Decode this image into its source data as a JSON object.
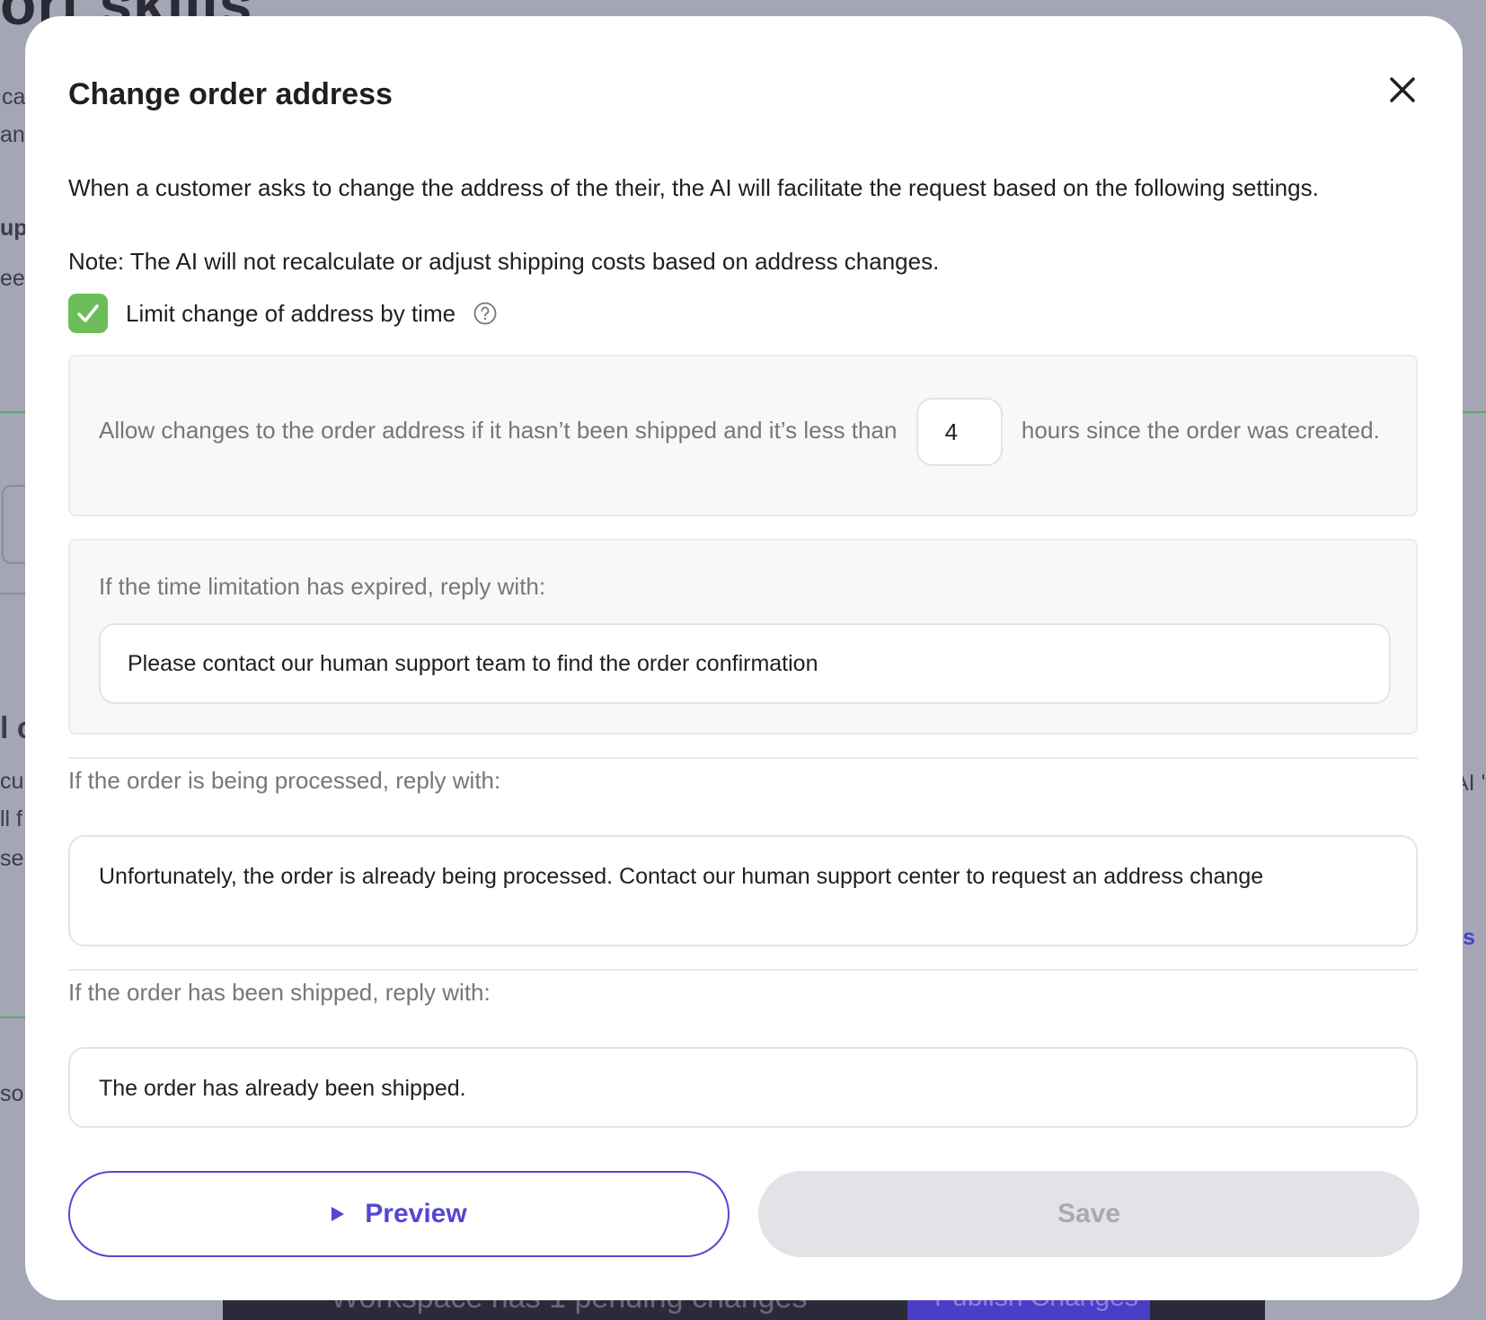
{
  "background": {
    "title_fragment": "ort skills",
    "fragments": [
      "ca",
      "an",
      "up",
      "ee",
      "l c",
      "cu",
      "ll f",
      "se",
      "so",
      "AI '",
      "s"
    ],
    "bottom_bar_text": "Workspace has 1 pending changes",
    "publish_label": "Publish Changes"
  },
  "modal": {
    "title": "Change order address",
    "description": "When a customer asks to change the address of the their, the AI will facilitate the request based on the following settings.",
    "note": "Note: The AI will not recalculate or adjust shipping costs based on address changes.",
    "limit_checkbox": {
      "label": "Limit change of address by time",
      "checked": true
    },
    "time_rule": {
      "prefix": "Allow changes to the order address if it hasn’t been shipped and it’s less than",
      "hours_value": "4",
      "suffix": "hours since the order was created."
    },
    "expired": {
      "label": "If the time limitation has expired, reply with:",
      "value": "Please contact our human support team to find the order confirmation"
    },
    "processing": {
      "label": "If the order is being processed, reply with:",
      "value": "Unfortunately, the order is already being processed. Contact our human support center to request an address change"
    },
    "shipped": {
      "label": "If the order has been shipped, reply with:",
      "value": "The order has already been shipped."
    },
    "buttons": {
      "preview": "Preview",
      "save": "Save"
    },
    "colors": {
      "accent": "#5447d3",
      "check": "#6cbd5a",
      "disabled": "#e2e2e7"
    },
    "icons": {
      "close": "close-icon",
      "help": "question-circle-icon",
      "check": "checkmark-icon",
      "play": "play-icon"
    }
  }
}
